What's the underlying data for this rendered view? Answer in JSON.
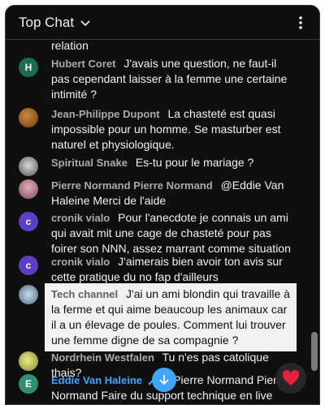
{
  "header": {
    "title": "Top Chat"
  },
  "top_cut_text": "relation",
  "messages": [
    {
      "author": "Hubert Coret",
      "avatar_letter": "H",
      "avatar_color": "#1e6b4f",
      "text": "J'avais une question, ne faut-il pas cependant laisser à la femme une certaine intimité ?"
    },
    {
      "author": "Jean-Philippe Dupont",
      "avatar_letter": "",
      "avatar_color": "#8a5a2b",
      "text": "La chasteté est quasi impossible pour un homme. Se masturber est naturel et physiologique."
    },
    {
      "author": "Spiritual Snake",
      "avatar_letter": "",
      "avatar_color": "#9a9a9a",
      "text": "Es-tu pour le mariage ?"
    },
    {
      "author": "Pierre Normand Pierre Normand",
      "avatar_letter": "",
      "avatar_color": "#a06a7a",
      "text": "@Eddie Van Haleine Merci de l'aide"
    },
    {
      "author": "cronik vialo",
      "avatar_letter": "c",
      "avatar_color": "#5c3fc4",
      "text": "Pour l'anecdote je connais un ami qui avait mit une cage de chasteté pour pas foirer son NNN, assez marrant comme situation"
    },
    {
      "author": "cronik vialo",
      "avatar_letter": "c",
      "avatar_color": "#5c3fc4",
      "text": "J'aimerais bien avoir ton avis sur cette pratique du no fap d'ailleurs"
    },
    {
      "author": "Tech channel",
      "avatar_letter": "",
      "avatar_color": "#6b8fa8",
      "text": "J'ai un ami blondin qui travaille à la ferme et qui aime beaucoup les animaux car il a un élevage de poules. Comment lui trouver une femme digne de sa compagnie ?"
    },
    {
      "author": "Nordrhein Westfalen",
      "avatar_letter": "",
      "avatar_color": "#c7c254",
      "text": "Tu n'es pas catolique thais?"
    },
    {
      "author": "Eddie Van Haleine",
      "avatar_letter": "E",
      "avatar_color": "#2f8f6e",
      "text": "@Pierre Normand Pierre Normand Faire du support technique en live c'est compliqué 😅"
    }
  ],
  "colors": {
    "owner": "#3ea6ff",
    "background": "#0f0f0f",
    "heart": "#e0243b"
  },
  "icons": {
    "dropdown": "chevron-down-icon",
    "menu": "more-vert-icon",
    "scroll": "arrow-down-icon",
    "reaction": "heart-icon",
    "moderator": "wrench-icon"
  }
}
